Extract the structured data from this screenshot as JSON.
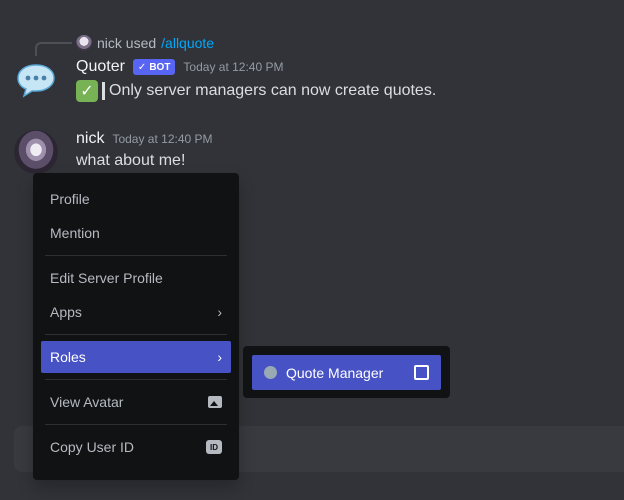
{
  "reply": {
    "user": "nick used",
    "command": "/allquote"
  },
  "bot_message": {
    "author": "Quoter",
    "badge": "BOT",
    "badge_check": "✓",
    "timestamp": "Today at 12:40 PM",
    "check_glyph": "✓",
    "text": "Only server managers can now create quotes."
  },
  "user_message": {
    "author": "nick",
    "timestamp": "Today at 12:40 PM",
    "text": "what about me!"
  },
  "context_menu": {
    "profile": "Profile",
    "mention": "Mention",
    "edit_server_profile": "Edit Server Profile",
    "apps": "Apps",
    "roles": "Roles",
    "view_avatar": "View Avatar",
    "copy_user_id": "Copy User ID",
    "chevron": "›",
    "id_badge": "ID"
  },
  "roles_submenu": {
    "items": [
      {
        "label": "Quote Manager",
        "color": "#99aab5",
        "checked": false
      }
    ]
  },
  "colors": {
    "background": "#313338",
    "accent": "#4752c4",
    "menu_bg": "#111214",
    "link": "#00a8fc"
  }
}
